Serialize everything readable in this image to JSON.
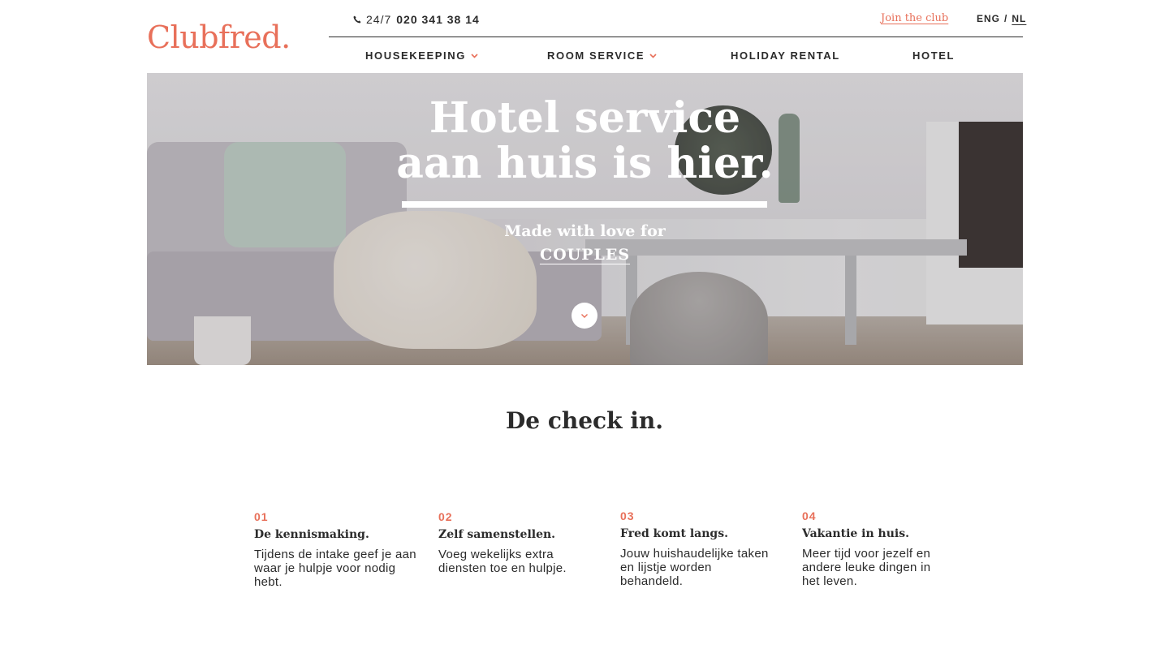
{
  "brand": {
    "logo": "Clubfred.",
    "accent_color": "#e8705a"
  },
  "topbar": {
    "phone_icon": "phone-icon",
    "phone_prefix": "24/7",
    "phone_number": "020 341 38 14",
    "join_link": "Join the club",
    "lang_en": "ENG",
    "lang_sep": "/",
    "lang_nl": "NL"
  },
  "nav": {
    "items": [
      {
        "label": "HOUSEKEEPING",
        "has_dropdown": true
      },
      {
        "label": "ROOM SERVICE",
        "has_dropdown": true
      },
      {
        "label": "HOLIDAY RENTAL",
        "has_dropdown": false
      },
      {
        "label": "HOTEL",
        "has_dropdown": false
      }
    ]
  },
  "hero": {
    "title_line1": "Hotel service",
    "title_line2": "aan huis is hier.",
    "subtitle": "Made with love for",
    "link": "COUPLES",
    "scroll_icon": "chevron-down-icon"
  },
  "checkin": {
    "title": "De check in.",
    "steps": [
      {
        "num": "01",
        "title": "De kennismaking.",
        "desc": "Tijdens de intake geef je aan waar je hulpje voor nodig hebt."
      },
      {
        "num": "02",
        "title": "Zelf samenstellen.",
        "desc": "Voeg wekelijks extra diensten toe en hulpje."
      },
      {
        "num": "03",
        "title": "Fred komt langs.",
        "desc": "Jouw huishaudelijke taken en lijstje worden behandeld."
      },
      {
        "num": "04",
        "title": "Vakantie in huis.",
        "desc": "Meer tijd voor jezelf en andere leuke dingen in het leven."
      }
    ]
  }
}
